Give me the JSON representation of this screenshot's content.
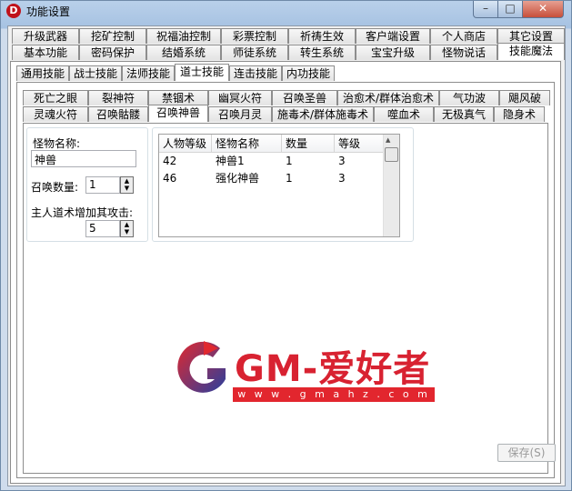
{
  "window": {
    "title": "功能设置",
    "app_icon_letter": "D"
  },
  "title_controls": {
    "minimize": "–",
    "maximize": "□",
    "close": "✕"
  },
  "tabs_row1": [
    "升级武器",
    "挖矿控制",
    "祝福油控制",
    "彩票控制",
    "祈祷生效",
    "客户端设置",
    "个人商店",
    "其它设置"
  ],
  "tabs_row2": [
    "基本功能",
    "密码保护",
    "结婚系统",
    "师徒系统",
    "转生系统",
    "宝宝升级",
    "怪物说话",
    "技能魔法"
  ],
  "tabs_row2_active": "技能魔法",
  "skill_tabs": [
    "通用技能",
    "战士技能",
    "法师技能",
    "道士技能",
    "连击技能",
    "内功技能"
  ],
  "skill_tabs_active": "道士技能",
  "spell_row1": [
    "死亡之眼",
    "裂神符",
    "禁锢术",
    "幽冥火符",
    "召唤圣兽",
    "治愈术/群体治愈术",
    "气功波",
    "飓风破"
  ],
  "spell_row2": [
    "灵魂火符",
    "召唤骷髅",
    "召唤神兽",
    "召唤月灵",
    "施毒术/群体施毒术",
    "噬血术",
    "无极真气",
    "隐身术"
  ],
  "spell_row2_active": "召唤神兽",
  "form": {
    "monster_name_label": "怪物名称:",
    "monster_name_value": "神兽",
    "summon_count_label": "召唤数量:",
    "summon_count_value": "1",
    "attack_label": "主人道术增加其攻击:",
    "attack_value": "5"
  },
  "table": {
    "headers": [
      "人物等级",
      "怪物名称",
      "数量",
      "等级"
    ],
    "rows": [
      [
        "42",
        "神兽1",
        "1",
        "3"
      ],
      [
        "46",
        "强化神兽",
        "1",
        "3"
      ]
    ]
  },
  "watermark": {
    "text": "GM-爱好者",
    "url": "w w w . g m a h z . c o m"
  },
  "save_button": "保存(S)",
  "icons": {
    "spin_up": "▲",
    "spin_down": "▼"
  },
  "colors": {
    "accent_red": "#d82231",
    "title_bar": "#b9d0ea"
  }
}
